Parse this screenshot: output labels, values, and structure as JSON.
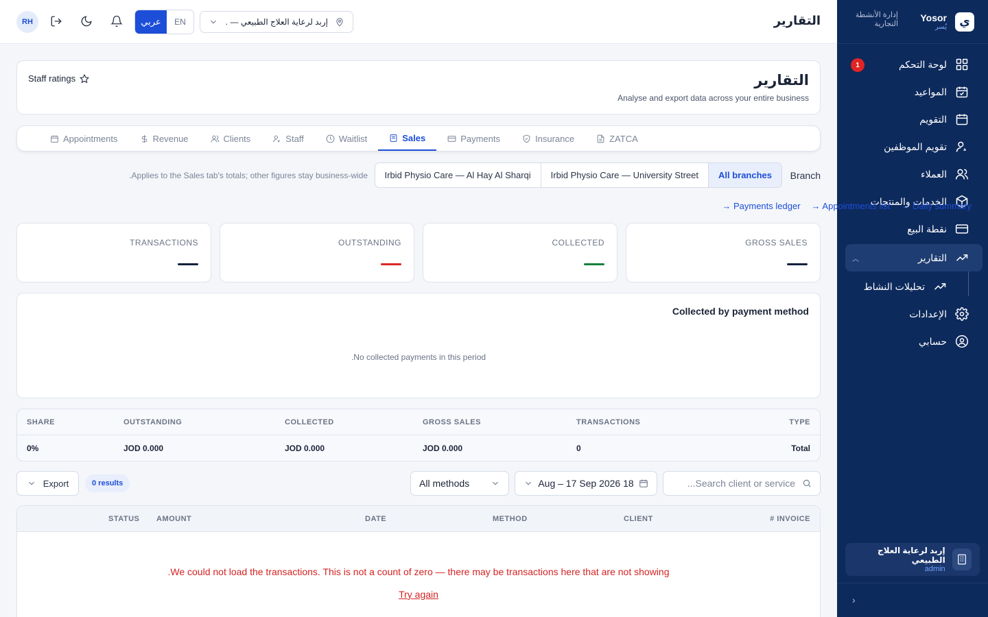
{
  "sidebar": {
    "brand_name": "Yosor",
    "brand_name_ar": "يُسر",
    "brand_logo_letter": "ي",
    "brand_subtitle": "إدارة الأنشطة التجارية",
    "items": [
      {
        "label": "لوحة التحكم",
        "icon": "dashboard-icon",
        "badge": "1"
      },
      {
        "label": "المواعيد",
        "icon": "calendar-check-icon"
      },
      {
        "label": "التقويم",
        "icon": "calendar-icon"
      },
      {
        "label": "تقويم الموظفين",
        "icon": "user-settings-icon"
      },
      {
        "label": "العملاء",
        "icon": "users-icon"
      },
      {
        "label": "الخدمات والمنتجات",
        "icon": "box-icon"
      },
      {
        "label": "نقطة البيع",
        "icon": "credit-card-icon"
      },
      {
        "label": "التقارير",
        "icon": "trend-icon",
        "active": true
      },
      {
        "label": "تحليلات النشاط",
        "icon": "trend-icon",
        "sub": true
      },
      {
        "label": "الإعدادات",
        "icon": "gear-icon"
      },
      {
        "label": "حسابي",
        "icon": "user-circle-icon"
      }
    ],
    "account": {
      "name": "إربد لرعاية العلاج الطبيعي",
      "role": "admin"
    }
  },
  "topbar": {
    "avatar_initials": "RH",
    "lang_ar": "عربي",
    "lang_en": "EN",
    "branch_value": "إربد لرعاية العلاج الطبيعي — ...",
    "title": "التقارير"
  },
  "header": {
    "title": "التقارير",
    "subtitle": "Analyse and export data across your entire business",
    "staff_ratings": "Staff ratings"
  },
  "tabs": [
    {
      "label": "Appointments",
      "icon": "calendar-icon"
    },
    {
      "label": "Revenue",
      "icon": "dollar-icon"
    },
    {
      "label": "Clients",
      "icon": "users-icon"
    },
    {
      "label": "Staff",
      "icon": "user-settings-icon"
    },
    {
      "label": "Waitlist",
      "icon": "clock-icon"
    },
    {
      "label": "Sales",
      "icon": "receipt-icon",
      "active": true
    },
    {
      "label": "Payments",
      "icon": "credit-card-icon"
    },
    {
      "label": "Insurance",
      "icon": "shield-icon"
    },
    {
      "label": "ZATCA",
      "icon": "document-icon"
    }
  ],
  "branch_filter": {
    "note": ".Applies to the Sales tab's totals; other figures stay business-wide",
    "options": [
      "Irbid Physio Care — Al Hay Al Sharqi",
      "Irbid Physio Care — University Street",
      "All branches"
    ],
    "selected": "All branches",
    "label": "Branch"
  },
  "quick_links": [
    "→ Payments ledger",
    "→ Appointments list",
    "→ Daily summary"
  ],
  "stats": [
    {
      "label": "TRANSACTIONS",
      "color": "#14213d"
    },
    {
      "label": "OUTSTANDING",
      "color": "#dc2626"
    },
    {
      "label": "COLLECTED",
      "color": "#16803c"
    },
    {
      "label": "GROSS SALES",
      "color": "#14213d"
    }
  ],
  "collected_card": {
    "title": "Collected by payment method",
    "empty": ".No collected payments in this period"
  },
  "summary_table": {
    "headers": [
      "SHARE",
      "OUTSTANDING",
      "COLLECTED",
      "GROSS SALES",
      "TRANSACTIONS",
      "TYPE"
    ],
    "row": [
      "0%",
      "JOD 0.000",
      "JOD 0.000",
      "JOD 0.000",
      "0",
      "Total"
    ]
  },
  "filters": {
    "export_label": "Export",
    "results": "0 results",
    "methods": "All methods",
    "date_range": "Aug – 17 Sep 2026 18",
    "search_placeholder": "...Search client or service"
  },
  "transactions": {
    "headers": [
      "STATUS",
      "AMOUNT",
      "DATE",
      "METHOD",
      "CLIENT",
      "# INVOICE"
    ],
    "error": ".We could not load the transactions. This is not a count of zero — there may be transactions here that are not showing",
    "retry": "Try again"
  }
}
